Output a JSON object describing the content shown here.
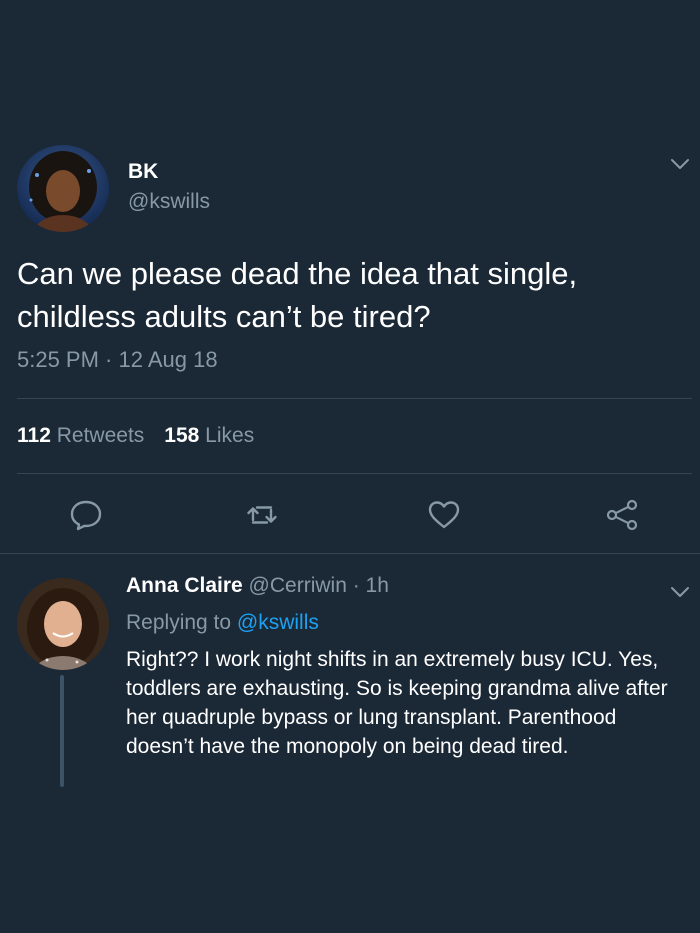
{
  "tweet": {
    "author_name": "BK",
    "author_handle": "@kswills",
    "text": "Can we please dead the idea that single, childless adults can’t be tired?",
    "timestamp": "5:25 PM · 12 Aug 18",
    "retweet_count": "112",
    "retweet_label": "Retweets",
    "like_count": "158",
    "like_label": "Likes",
    "menu_icon": "chevron-down-icon"
  },
  "actions": [
    {
      "icon": "reply-icon"
    },
    {
      "icon": "retweet-icon"
    },
    {
      "icon": "heart-icon"
    },
    {
      "icon": "share-icon"
    }
  ],
  "reply": {
    "author_name": "Anna Claire",
    "author_meta": "@Cerriwin · 1h",
    "replying_prefix": "Replying to",
    "replying_handle": "@kswills",
    "text": "Right?? I work night shifts in an extremely busy ICU. Yes, toddlers are exhausting. So is keeping grandma alive after her quadruple bypass or lung transplant. Parenthood doesn’t have the monopoly on being dead tired.",
    "menu_icon": "chevron-down-icon"
  },
  "colors": {
    "background": "#1b2836",
    "secondary_text": "#8899a6",
    "link": "#1da1f2",
    "divider": "#38444d"
  }
}
